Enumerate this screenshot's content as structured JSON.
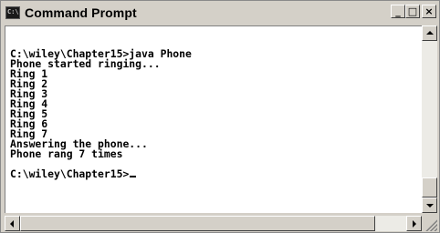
{
  "window": {
    "title": "Command Prompt",
    "icon": "console-icon",
    "buttons": {
      "minimize": "_",
      "maximize": "□",
      "close": "×"
    }
  },
  "console": {
    "lines": [
      "",
      "C:\\wiley\\Chapter15>java Phone",
      "Phone started ringing...",
      "Ring 1",
      "Ring 2",
      "Ring 3",
      "Ring 4",
      "Ring 5",
      "Ring 6",
      "Ring 7",
      "Answering the phone...",
      "Phone rang 7 times",
      "",
      "C:\\wiley\\Chapter15>"
    ],
    "cursor": "_"
  },
  "scrollbars": {
    "vertical_position": 1.0,
    "horizontal_position": 0.0,
    "horizontal_visible_fraction": 0.92
  }
}
